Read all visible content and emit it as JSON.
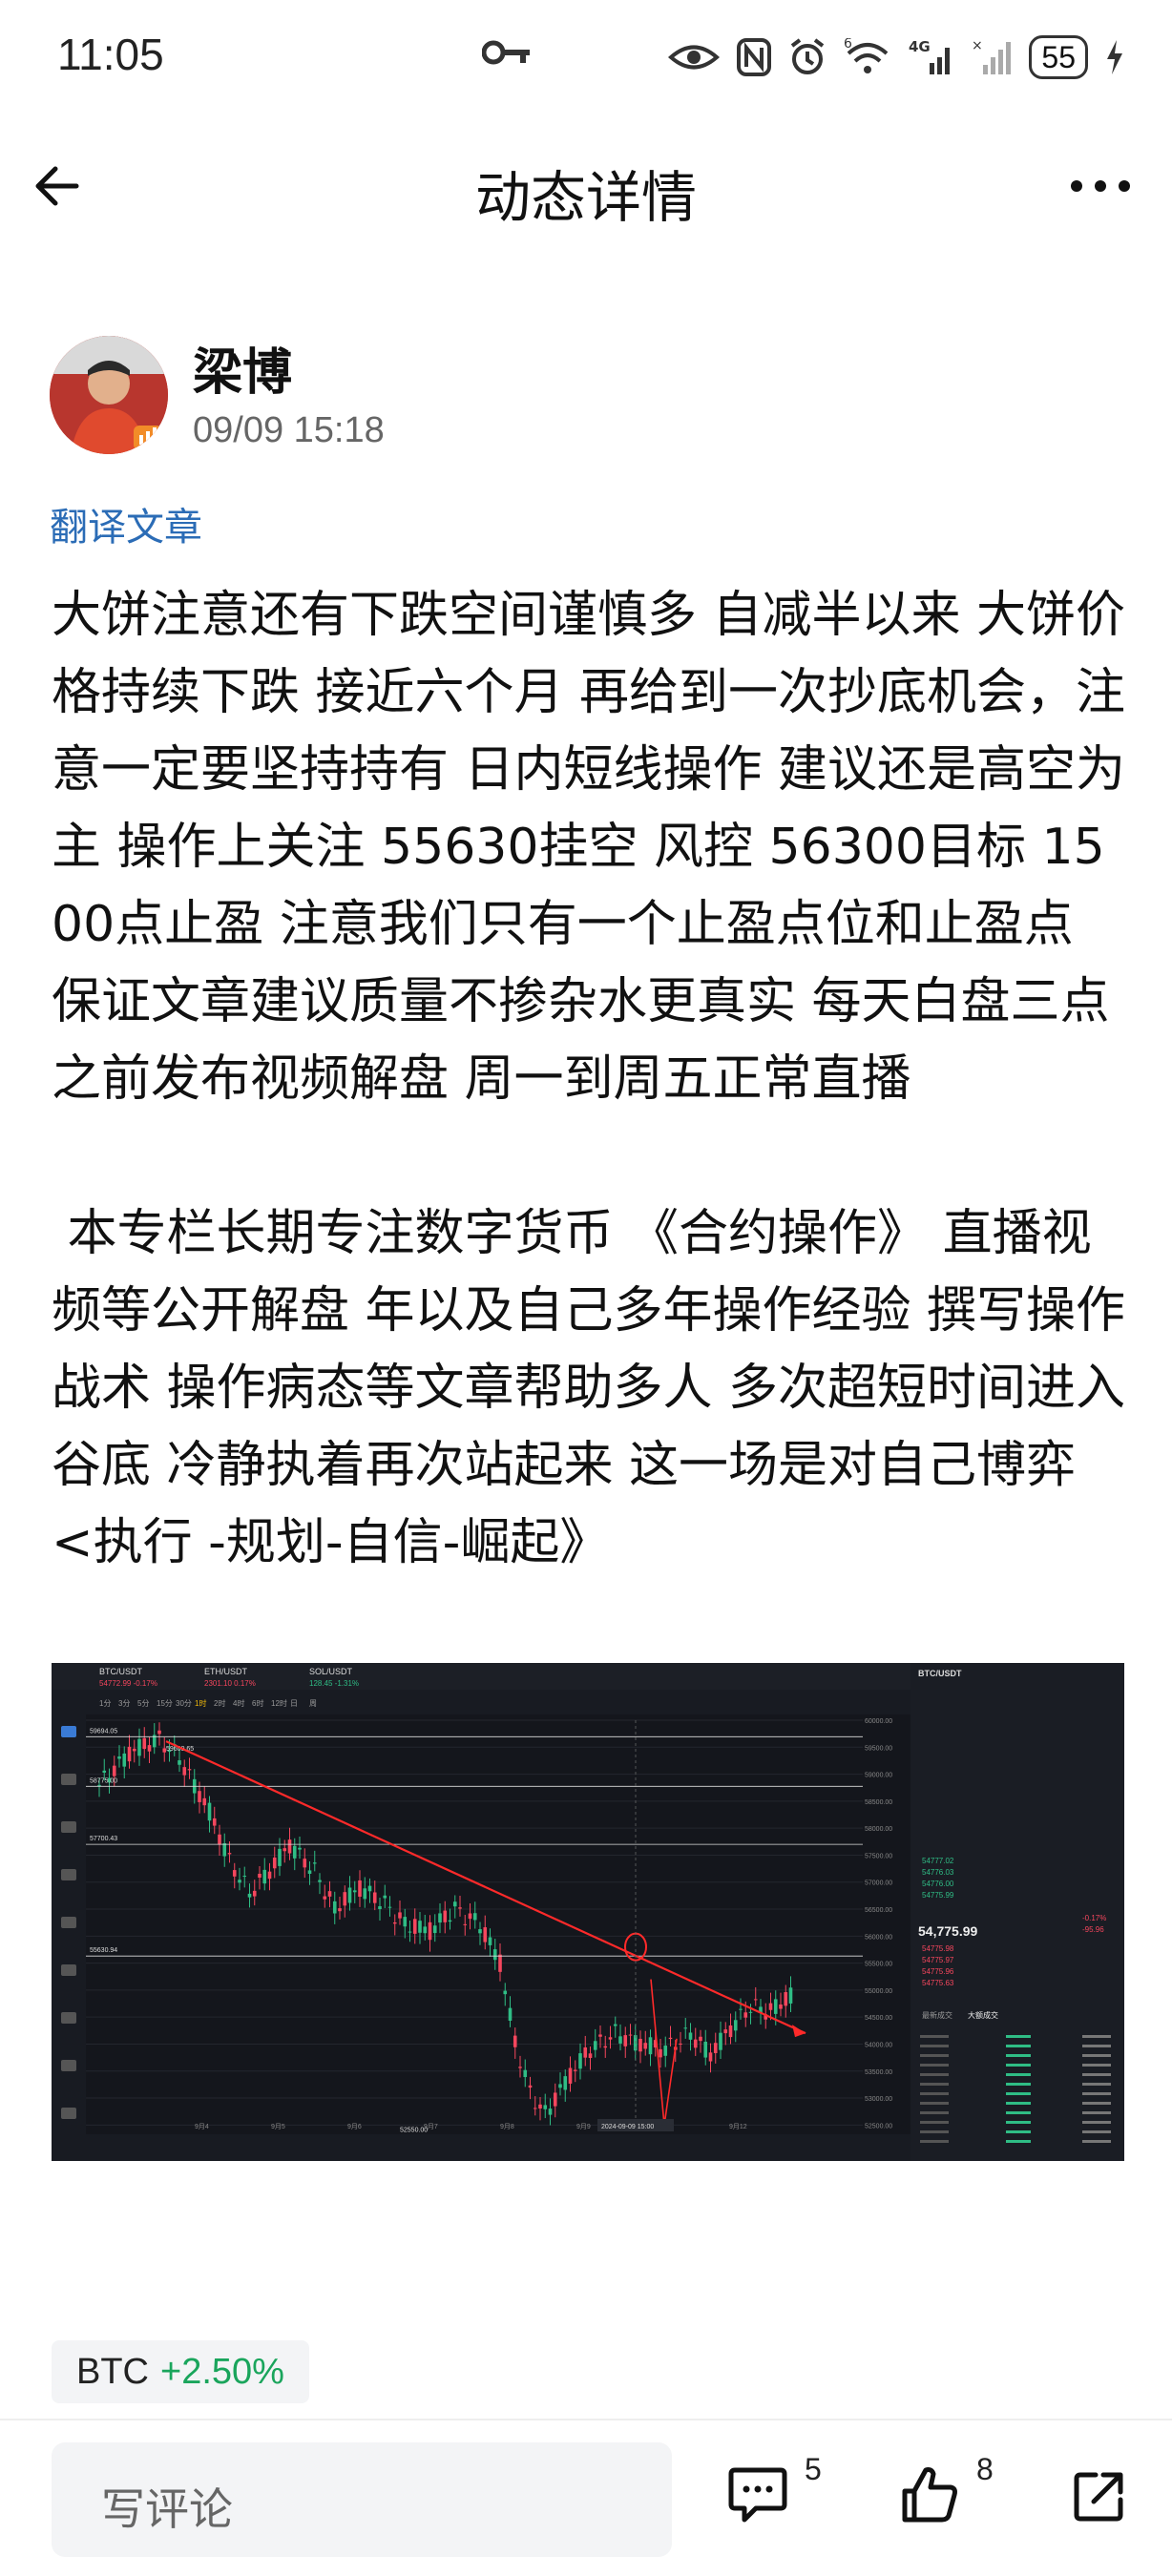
{
  "status_bar": {
    "time": "11:05",
    "signal": "4G",
    "wifi_badge": "6",
    "battery": "55",
    "icons": [
      "key-icon",
      "eye-icon",
      "nfc-icon",
      "alarm-icon",
      "wifi-icon",
      "signal-icon",
      "battery-icon",
      "charging-icon"
    ]
  },
  "nav": {
    "back_icon": "arrow-left-icon",
    "title": "动态详情",
    "more_icon": "more-horizontal-icon"
  },
  "author": {
    "name": "梁博",
    "time": "09/09 15:18"
  },
  "translate_link": "翻译文章",
  "post": {
    "paragraph_1": "大饼注意还有下跌空间谨慎多 自减半以来 大饼价格持续下跌 接近六个月 再给到一次抄底机会，注意一定要坚持持有 日内短线操作 建议还是高空为主 操作上关注 55630挂空 风控 56300目标 1500点止盈 注意我们只有一个止盈点位和止盈点 保证文章建议质量不掺杂水更真实 每天白盘三点之前发布视频解盘 周一到周五正常直播",
    "paragraph_2": " 本专栏长期专注数字货币 《合约操作》 直播视频等公开解盘 年以及自己多年操作经验 撰写操作战术 操作病态等文章帮助多人 多次超短时间进入谷底 冷静执着再次站起来 这一场是对自己博弈 <执行 -规划-自信-崛起》"
  },
  "chart_image": {
    "tabs": [
      "BTC/USDT",
      "ETH/USDT",
      "SOL/USDT"
    ],
    "tab_prices": [
      "54772.99 -0.17%",
      "2301.10 0.17%",
      "128.45 -1.31%"
    ],
    "timeframes": [
      "1分",
      "3分",
      "5分",
      "15分",
      "30分",
      "1时",
      "2时",
      "4时",
      "6时",
      "12时",
      "日",
      "周"
    ],
    "price_labels": [
      "59694.05",
      "59609.65",
      "58775.00",
      "57700.43",
      "55630.94",
      "52550.00"
    ],
    "x_labels": [
      "9月4",
      "9月5",
      "9月6",
      "9月7",
      "9月8",
      "9月9",
      "9月11",
      "9月12"
    ],
    "crosshair_label": "2024-09-09 15:00",
    "axis_labels": [
      "60000.00",
      "59500.00",
      "59000.00",
      "58500.00",
      "58000.00",
      "57500.00",
      "57000.00",
      "56500.00",
      "56000.00",
      "55500.00",
      "55000.00",
      "54500.00",
      "54000.00",
      "53500.00",
      "53000.00",
      "52500.00"
    ],
    "right_panel_title": "BTC/USDT",
    "right_price": "54,775.99",
    "right_change": "-95.96",
    "right_pct": "-0.17%",
    "order_asks": [
      "54777.02",
      "54776.03",
      "54776.00",
      "54775.99"
    ],
    "order_bids": [
      "54775.98",
      "54775.97",
      "54775.96",
      "54775.63"
    ],
    "bottom_tabs": [
      "最新成交",
      "大额成交"
    ],
    "trend_line": {
      "from_price": 59609.65,
      "to_price": 54200,
      "from": "9月4",
      "to": "9月12"
    }
  },
  "tag": {
    "symbol": "BTC",
    "change": "+2.50%"
  },
  "bottom_bar": {
    "comment_placeholder": "写评论",
    "comment_count": "5",
    "like_count": "8",
    "comment_icon": "comment-icon",
    "like_icon": "thumbs-up-icon",
    "share_icon": "share-icon"
  }
}
